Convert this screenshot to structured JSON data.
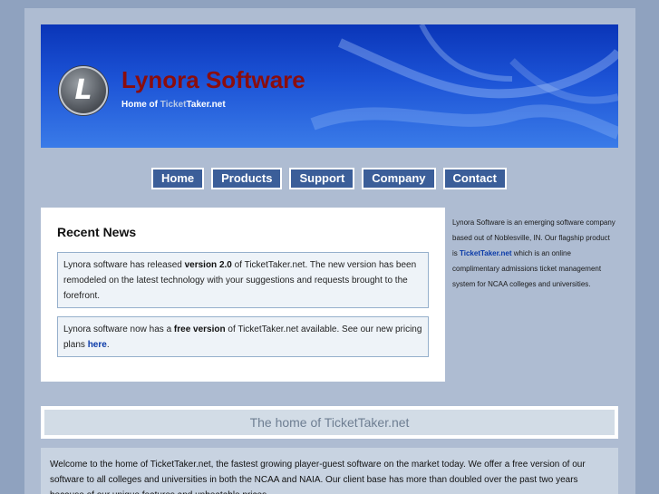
{
  "header": {
    "logo_letter": "L",
    "title": "Lynora Software",
    "tagline_prefix": "Home of ",
    "tagline_part1": "Ticket",
    "tagline_part2": "Taker.net"
  },
  "nav": {
    "items": [
      {
        "label": "Home"
      },
      {
        "label": "Products"
      },
      {
        "label": "Support"
      },
      {
        "label": "Company"
      },
      {
        "label": "Contact"
      }
    ]
  },
  "news": {
    "title": "Recent News",
    "item1": {
      "text_a": "Lynora software has released ",
      "bold": "version 2.0",
      "text_b": " of TicketTaker.net. The new version has been remodeled on the latest technology with your suggestions and requests brought to the forefront."
    },
    "item2": {
      "text_a": "Lynora software now has a ",
      "bold": "free version",
      "text_b": " of TicketTaker.net available. See our new pricing plans ",
      "link": "here",
      "text_c": "."
    }
  },
  "sidebar": {
    "text_a": "Lynora Software is an emerging software company based out of Noblesville, IN. Our flagship product is ",
    "link": "TicketTaker.net",
    "text_b": " which is an online complimentary admissions ticket management system for NCAA colleges and universities."
  },
  "banner": {
    "text": "The home of TicketTaker.net"
  },
  "welcome": {
    "text": "Welcome to the home of TicketTaker.net, the fastest growing player-guest software on the market today. We offer a free version of our software to all colleges and universities in both the NCAA and NAIA. Our client base has more than doubled over the past two years because of our unique features and unbeatable prices."
  },
  "colors": {
    "header_blue": "#1c53d6",
    "title_red": "#8b0d0d",
    "nav_blue": "#3b5e99",
    "link_blue": "#0a3aa8",
    "page_bg": "#aebcd2"
  }
}
